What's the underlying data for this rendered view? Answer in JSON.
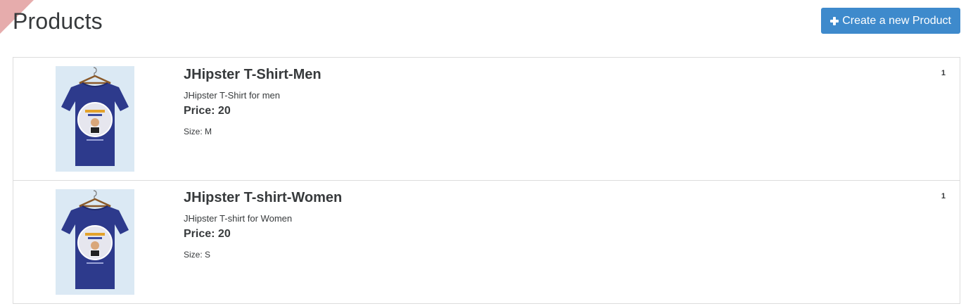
{
  "header": {
    "title": "Products",
    "create_button_label": "Create a new Product",
    "create_button_icon": "plus-icon"
  },
  "colors": {
    "primary_button": "#3e8acc",
    "ribbon": "#d98c8c",
    "shirt": "#2d3a8c",
    "image_background": "#dbe9f4"
  },
  "products": [
    {
      "name": "JHipster T-Shirt-Men",
      "description": "JHipster T-Shirt for men",
      "price": "Price: 20",
      "size": "Size: M",
      "quantity": "1",
      "image": "t-shirt-image"
    },
    {
      "name": "JHipster T-shirt-Women",
      "description": "JHipster T-shirt for Women",
      "price": "Price: 20",
      "size": "Size: S",
      "quantity": "1",
      "image": "t-shirt-image"
    }
  ]
}
